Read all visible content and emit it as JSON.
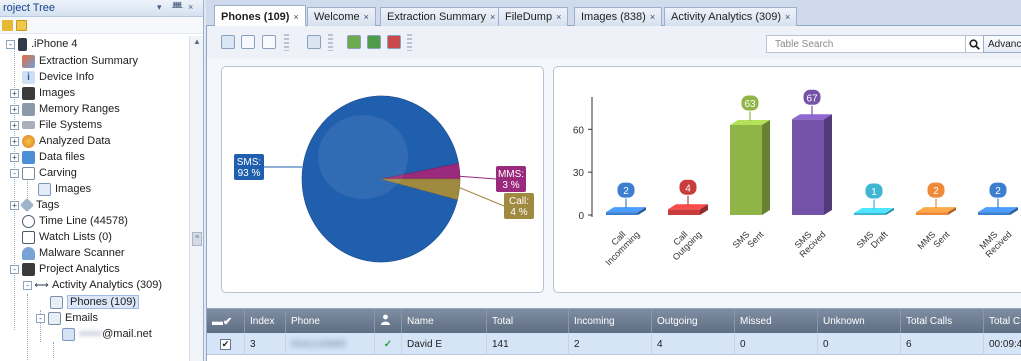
{
  "tree": {
    "title": "roject Tree",
    "header_buttons": [
      "▾",
      "ᚙ",
      "×"
    ],
    "items": [
      {
        "label": ".iPhone 4",
        "icon": "phone-icon",
        "expander": "-"
      },
      {
        "label": "Extraction Summary",
        "icon": "summary-icon"
      },
      {
        "label": "Device Info",
        "icon": "device-info-icon"
      },
      {
        "label": "Images",
        "icon": "images-icon",
        "expander": "+"
      },
      {
        "label": "Memory Ranges",
        "icon": "memory-icon",
        "expander": "+"
      },
      {
        "label": "File Systems",
        "icon": "filesystem-icon",
        "expander": "+"
      },
      {
        "label": "Analyzed Data",
        "icon": "analyzed-data-icon",
        "expander": "+"
      },
      {
        "label": "Data files",
        "icon": "data-files-icon",
        "expander": "+"
      },
      {
        "label": "Carving",
        "icon": "carving-icon",
        "expander": "-"
      },
      {
        "label": "Images",
        "icon": "images-icon"
      },
      {
        "label": "Tags",
        "icon": "tag-icon",
        "expander": "+"
      },
      {
        "label": "Time Line (44578)",
        "icon": "clock-icon"
      },
      {
        "label": "Watch Lists (0)",
        "icon": "watch-list-icon"
      },
      {
        "label": "Malware Scanner",
        "icon": "malware-icon"
      },
      {
        "label": "Project Analytics",
        "icon": "analytics-icon",
        "expander": "-"
      },
      {
        "label": "Activity Analytics (309)",
        "icon": "activity-icon",
        "expander": "-"
      },
      {
        "label": "Phones (109)",
        "icon": "grid-icon"
      },
      {
        "label": "Emails",
        "icon": "email-icon",
        "expander": "-"
      },
      {
        "label": "@mail.net",
        "icon": "email-icon",
        "blurred_prefix": "••••••"
      }
    ]
  },
  "tabs": [
    {
      "label": "Phones (109)",
      "active": true
    },
    {
      "label": "Welcome"
    },
    {
      "label": "Extraction Summary"
    },
    {
      "label": "FileDump"
    },
    {
      "label": "Images (838)"
    },
    {
      "label": "Activity Analytics (309)"
    }
  ],
  "tab_close": "×",
  "toolbar": {
    "search_placeholder": "Table Search",
    "advanced_label": "Advanced"
  },
  "colors": {
    "sms": "#1f5fae",
    "mms": "#9a2a7c",
    "call": "#a08a40",
    "bar_blue": "#3c7ed0",
    "bar_red": "#c83c3c",
    "bar_green": "#8fb447",
    "bar_purple": "#7352a8",
    "bar_cyan": "#3fb7d3",
    "bar_orange": "#f0883a"
  },
  "chart_data": [
    {
      "type": "pie",
      "title": "",
      "slices": [
        {
          "name": "SMS:",
          "value": 93,
          "label": "93 %"
        },
        {
          "name": "MMS:",
          "value": 3,
          "label": "3 %"
        },
        {
          "name": "Call:",
          "value": 4,
          "label": "4 %"
        }
      ]
    },
    {
      "type": "bar",
      "title": "",
      "categories": [
        [
          "Call",
          "Incomming"
        ],
        [
          "Call",
          "Outgoing"
        ],
        [
          "SMS",
          "Sent"
        ],
        [
          "SMS",
          "Recived"
        ],
        [
          "SMS",
          "Draft"
        ],
        [
          "MMS",
          "Sent"
        ],
        [
          "MMS",
          "Recived"
        ]
      ],
      "values": [
        2,
        4,
        63,
        67,
        1,
        2,
        2
      ],
      "ylim": [
        0,
        70
      ],
      "yticks": [
        0,
        30,
        60
      ],
      "grid": false
    }
  ],
  "grid": {
    "columns": [
      "Index",
      "Phone",
      "",
      "Name",
      "Total",
      "Incoming",
      "Outgoing",
      "Missed",
      "Unknown",
      "Total Calls",
      "Total C"
    ],
    "row": {
      "checked": true,
      "index": "3",
      "phone": "0541133880",
      "status": "✓",
      "name": "David E",
      "total": "141",
      "incoming": "2",
      "outgoing": "4",
      "missed": "0",
      "unknown": "0",
      "total_calls": "6",
      "total_c": "00:09:4"
    }
  }
}
